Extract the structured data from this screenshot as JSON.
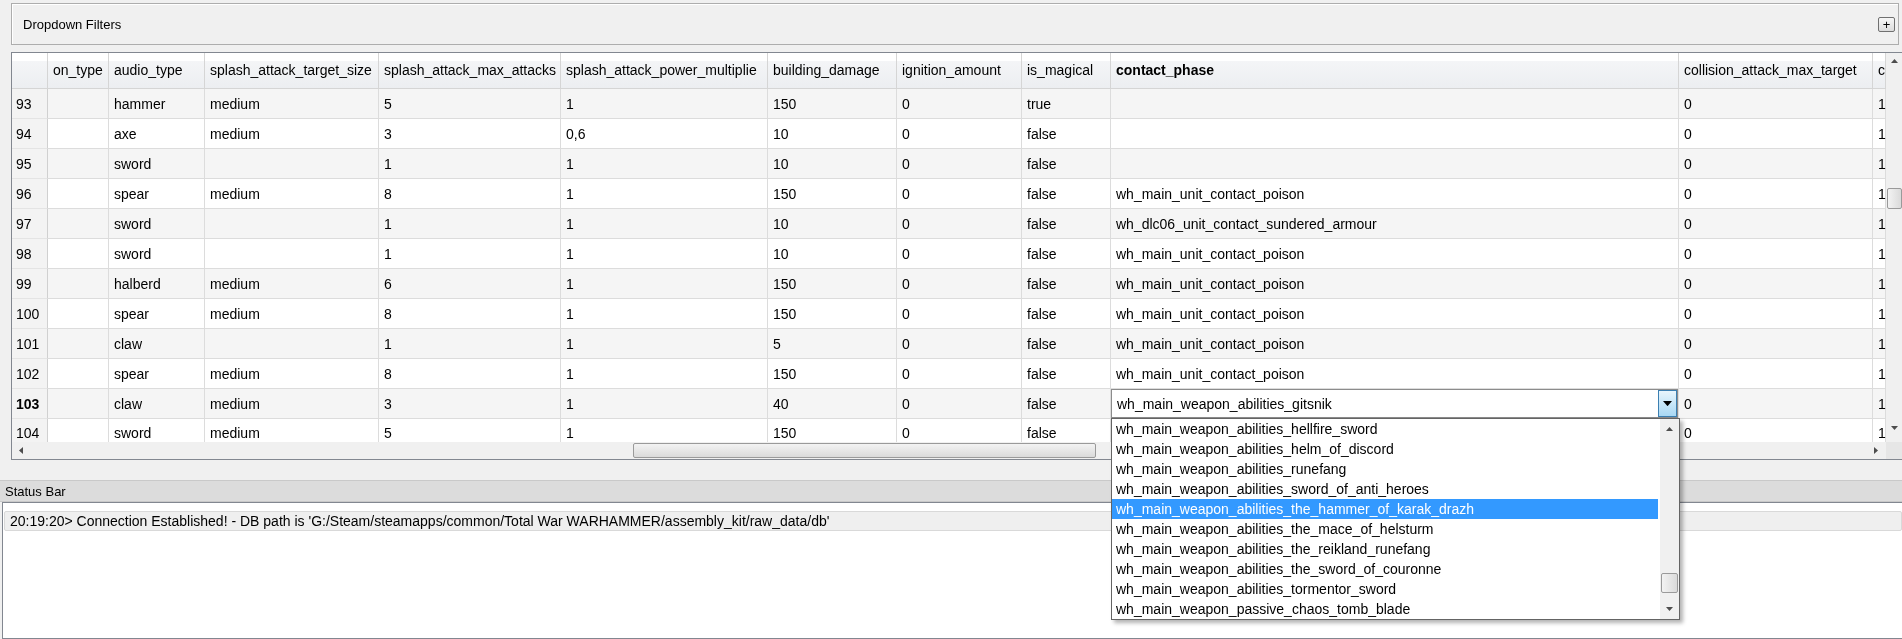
{
  "filters_panel": {
    "title": "Dropdown Filters",
    "button": "+"
  },
  "table": {
    "columns": [
      {
        "label": "on_type",
        "selected": false
      },
      {
        "label": "audio_type",
        "selected": false
      },
      {
        "label": "splash_attack_target_size",
        "selected": false
      },
      {
        "label": "splash_attack_max_attacks",
        "selected": false
      },
      {
        "label": "splash_attack_power_multiplie",
        "selected": false
      },
      {
        "label": "building_damage",
        "selected": false
      },
      {
        "label": "ignition_amount",
        "selected": false
      },
      {
        "label": "is_magical",
        "selected": false
      },
      {
        "label": "contact_phase",
        "selected": true
      },
      {
        "label": "collision_attack_max_target",
        "selected": false
      },
      {
        "label": "c",
        "selected": false
      }
    ],
    "rows": [
      {
        "number": "93",
        "selected": false,
        "cells": [
          null,
          "hammer",
          "medium",
          "5",
          "1",
          "150",
          "0",
          "true",
          null,
          "0",
          "1"
        ]
      },
      {
        "number": "94",
        "selected": false,
        "cells": [
          null,
          "axe",
          "medium",
          "3",
          "0,6",
          "10",
          "0",
          "false",
          null,
          "0",
          "1"
        ]
      },
      {
        "number": "95",
        "selected": false,
        "cells": [
          null,
          "sword",
          null,
          "1",
          "1",
          "10",
          "0",
          "false",
          null,
          "0",
          "1"
        ]
      },
      {
        "number": "96",
        "selected": false,
        "cells": [
          null,
          "spear",
          "medium",
          "8",
          "1",
          "150",
          "0",
          "false",
          "wh_main_unit_contact_poison",
          "0",
          "1"
        ]
      },
      {
        "number": "97",
        "selected": false,
        "cells": [
          null,
          "sword",
          null,
          "1",
          "1",
          "10",
          "0",
          "false",
          "wh_dlc06_unit_contact_sundered_armour",
          "0",
          "1"
        ]
      },
      {
        "number": "98",
        "selected": false,
        "cells": [
          null,
          "sword",
          null,
          "1",
          "1",
          "10",
          "0",
          "false",
          "wh_main_unit_contact_poison",
          "0",
          "1"
        ]
      },
      {
        "number": "99",
        "selected": false,
        "cells": [
          null,
          "halberd",
          "medium",
          "6",
          "1",
          "150",
          "0",
          "false",
          "wh_main_unit_contact_poison",
          "0",
          "1"
        ]
      },
      {
        "number": "100",
        "selected": false,
        "cells": [
          null,
          "spear",
          "medium",
          "8",
          "1",
          "150",
          "0",
          "false",
          "wh_main_unit_contact_poison",
          "0",
          "1"
        ]
      },
      {
        "number": "101",
        "selected": false,
        "cells": [
          null,
          "claw",
          null,
          "1",
          "1",
          "5",
          "0",
          "false",
          "wh_main_unit_contact_poison",
          "0",
          "1"
        ]
      },
      {
        "number": "102",
        "selected": false,
        "cells": [
          null,
          "spear",
          "medium",
          "8",
          "1",
          "150",
          "0",
          "false",
          "wh_main_unit_contact_poison",
          "0",
          "1"
        ]
      },
      {
        "number": "103",
        "selected": true,
        "cells": [
          null,
          "claw",
          "medium",
          "3",
          "1",
          "40",
          "0",
          "false",
          {
            "kind": "combo",
            "value": "wh_main_weapon_abilities_gitsnik",
            "expanded": true,
            "options": [
              {
                "label": "wh_main_weapon_abilities_hellfire_sword",
                "selected": false
              },
              {
                "label": "wh_main_weapon_abilities_helm_of_discord",
                "selected": false
              },
              {
                "label": "wh_main_weapon_abilities_runefang",
                "selected": false
              },
              {
                "label": "wh_main_weapon_abilities_sword_of_anti_heroes",
                "selected": false
              },
              {
                "label": "wh_main_weapon_abilities_the_hammer_of_karak_drazh",
                "selected": true
              },
              {
                "label": "wh_main_weapon_abilities_the_mace_of_helsturm",
                "selected": false
              },
              {
                "label": "wh_main_weapon_abilities_the_reikland_runefang",
                "selected": false
              },
              {
                "label": "wh_main_weapon_abilities_the_sword_of_couronne",
                "selected": false
              },
              {
                "label": "wh_main_weapon_abilities_tormentor_sword",
                "selected": false
              },
              {
                "label": "wh_main_weapon_passive_chaos_tomb_blade",
                "selected": false
              }
            ]
          },
          "0",
          "1"
        ]
      },
      {
        "number": "104",
        "selected": false,
        "cells": [
          null,
          "sword",
          "medium",
          "5",
          "1",
          "150",
          "0",
          "false",
          null,
          "0",
          "1"
        ]
      }
    ]
  },
  "status_bar": {
    "title": "Status Bar",
    "messages": [
      {
        "text": "20:19:20> Connection Established! - DB path is 'G:/Steam/steamapps/common/Total War WARHAMMER/assembly_kit/raw_data/db'",
        "selected": true
      }
    ]
  }
}
